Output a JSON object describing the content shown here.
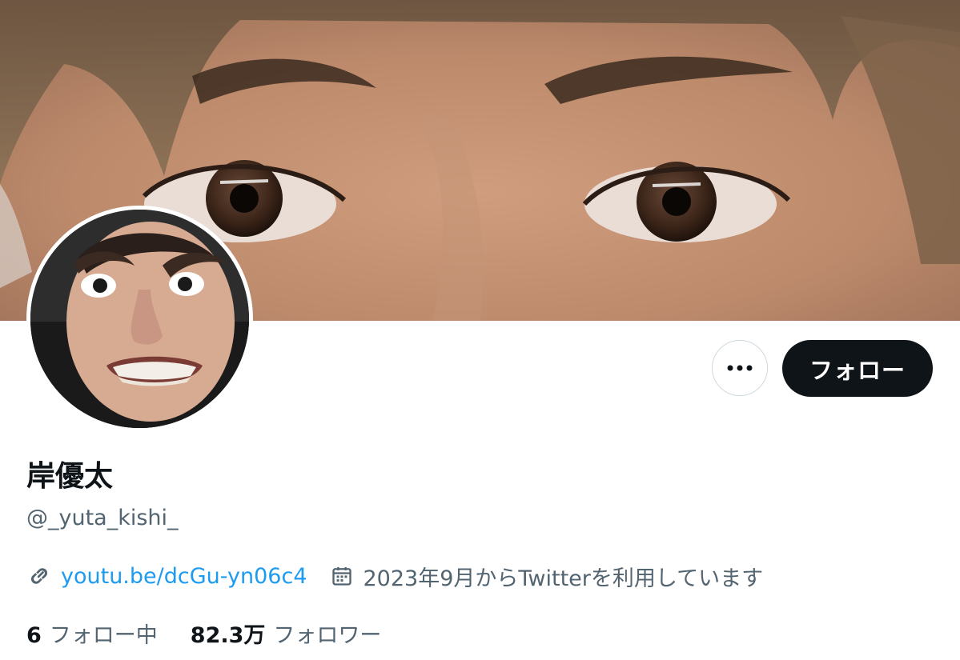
{
  "profile": {
    "display_name": "岸優太",
    "handle": "@_yuta_kishi_",
    "link_text": "youtu.be/dcGu-yn06c4",
    "joined_text": "2023年9月からTwitterを利用しています"
  },
  "actions": {
    "follow_label": "フォロー",
    "more_icon": "more-dots-icon"
  },
  "stats": {
    "following_count": "6",
    "following_label": "フォロー中",
    "followers_count": "82.3万",
    "followers_label": "フォロワー"
  },
  "icons": {
    "link": "link-icon",
    "calendar": "calendar-icon"
  },
  "colors": {
    "text_primary": "#0f1419",
    "text_secondary": "#536471",
    "link": "#1d9bf0",
    "follow_button_bg": "#0f1419",
    "border": "#cfd9de"
  }
}
